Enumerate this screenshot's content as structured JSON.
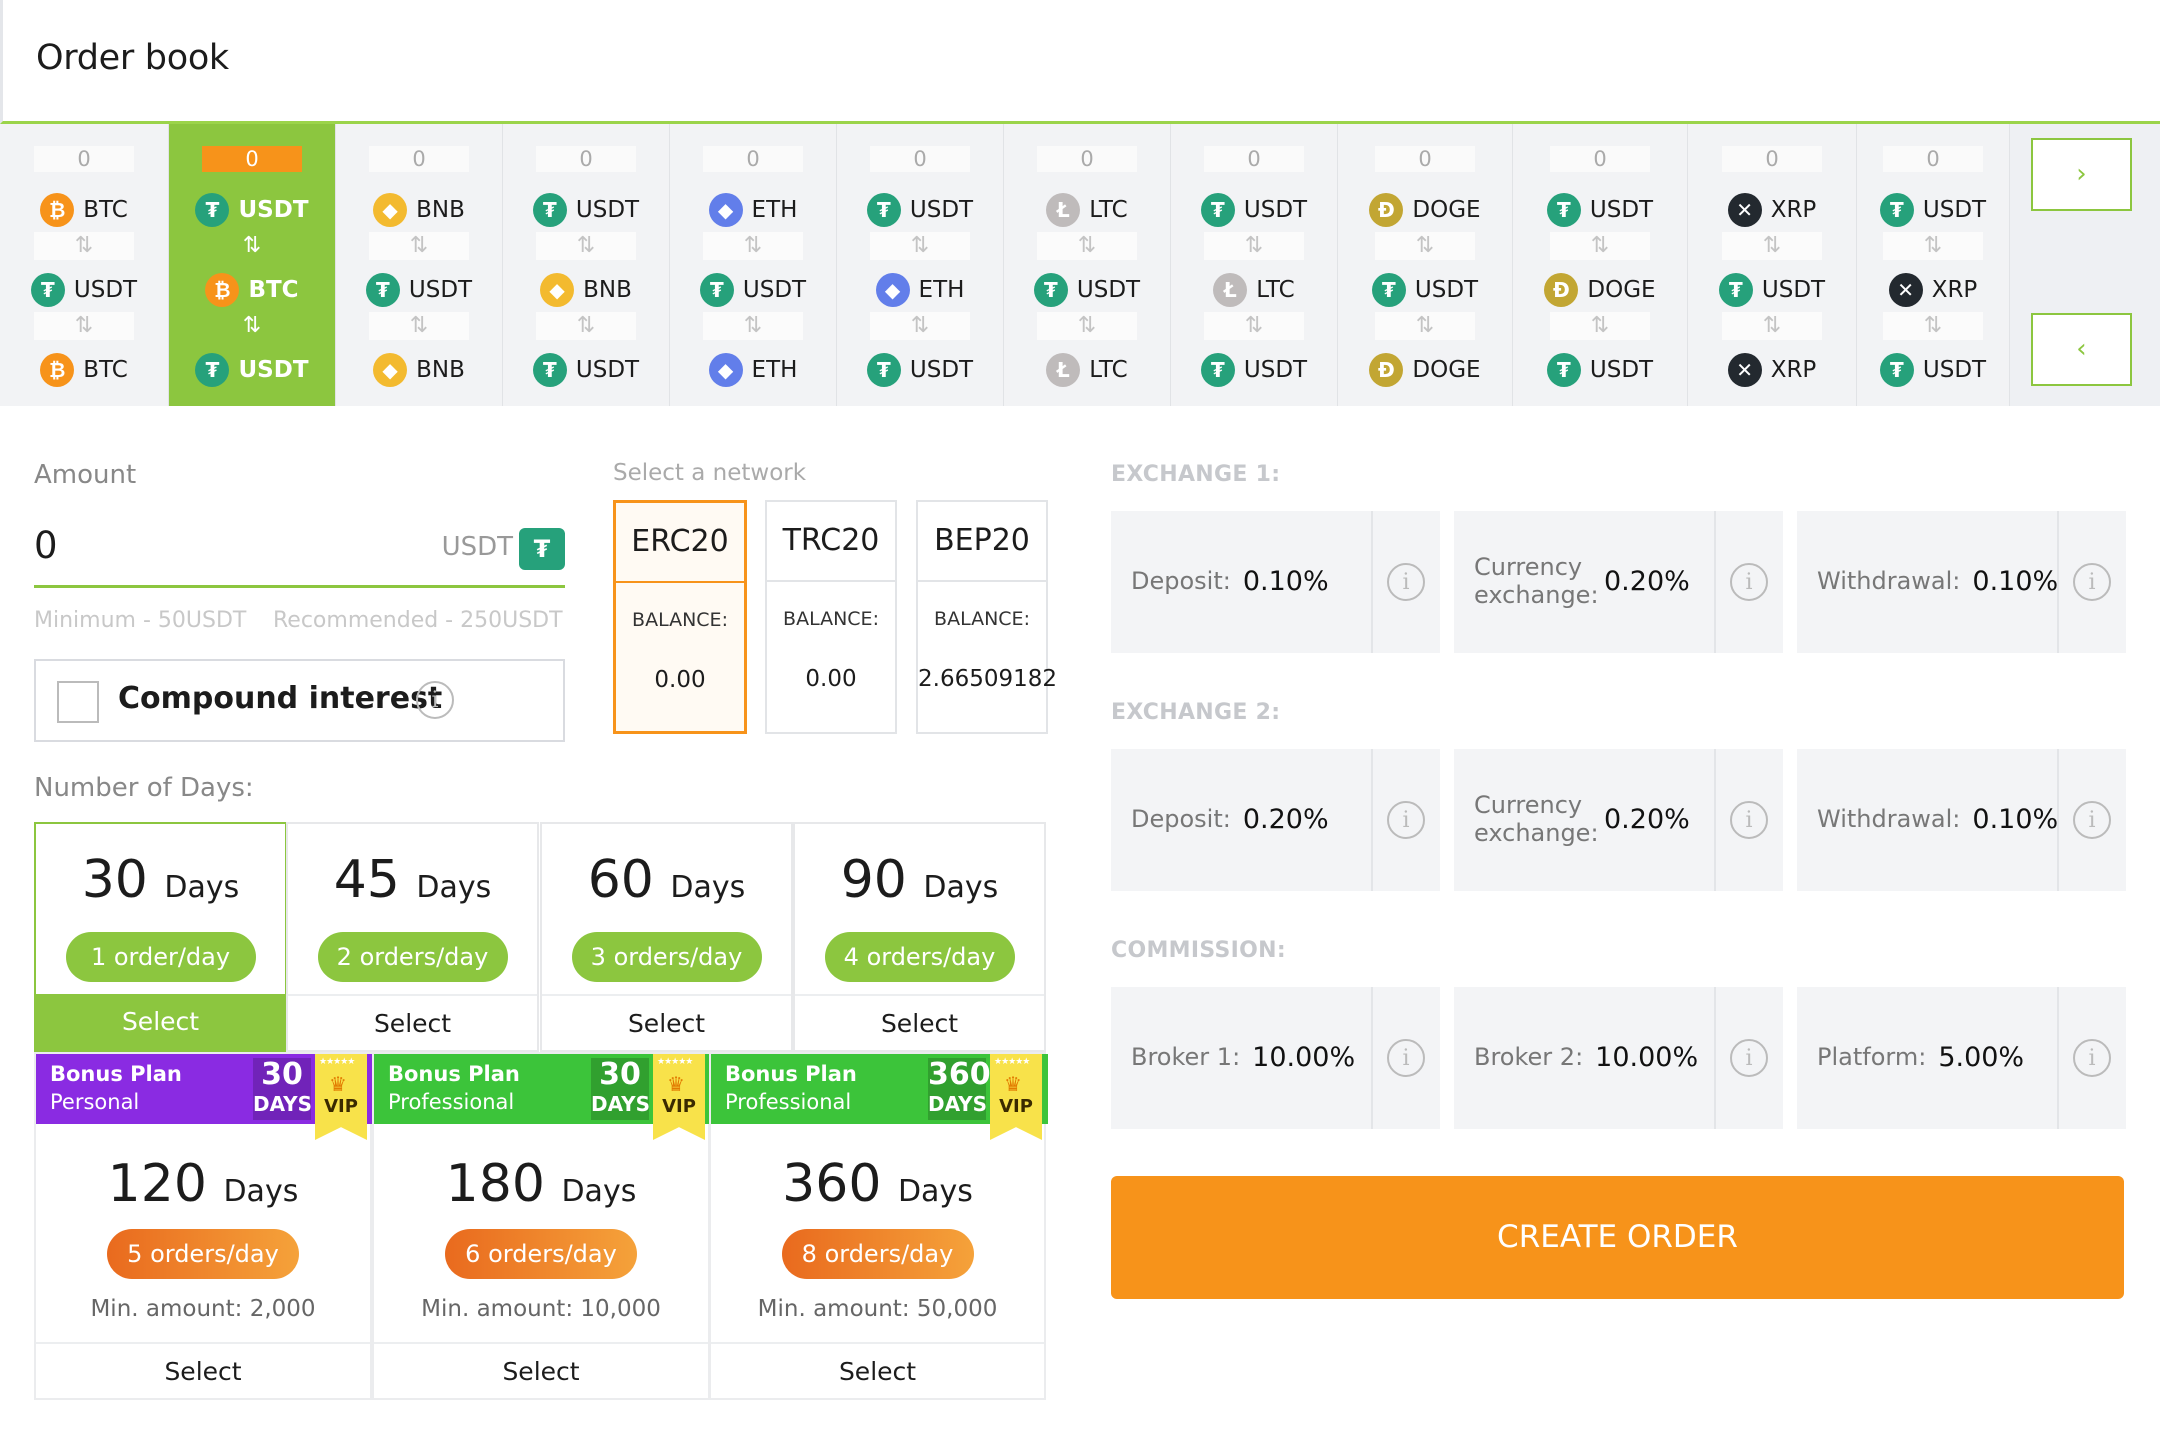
{
  "header": {
    "title": "Order book"
  },
  "pairs": [
    {
      "count": "0",
      "from": {
        "name": "BTC",
        "icon": "btc-icon",
        "cls": "c-btc",
        "glyph": "₿"
      },
      "to": {
        "name": "USDT",
        "icon": "usdt-icon",
        "cls": "c-usdt",
        "glyph": "₮"
      },
      "back": {
        "name": "BTC",
        "icon": "btc-icon",
        "cls": "c-btc",
        "glyph": "₿"
      }
    },
    {
      "count": "0",
      "from": {
        "name": "USDT",
        "icon": "usdt-icon",
        "cls": "c-usdt",
        "glyph": "₮"
      },
      "to": {
        "name": "BTC",
        "icon": "btc-icon",
        "cls": "c-btc",
        "glyph": "₿"
      },
      "back": {
        "name": "USDT",
        "icon": "usdt-icon",
        "cls": "c-usdt",
        "glyph": "₮"
      }
    },
    {
      "count": "0",
      "from": {
        "name": "BNB",
        "icon": "bnb-icon",
        "cls": "c-bnb",
        "glyph": "◆"
      },
      "to": {
        "name": "USDT",
        "icon": "usdt-icon",
        "cls": "c-usdt",
        "glyph": "₮"
      },
      "back": {
        "name": "BNB",
        "icon": "bnb-icon",
        "cls": "c-bnb",
        "glyph": "◆"
      }
    },
    {
      "count": "0",
      "from": {
        "name": "USDT",
        "icon": "usdt-icon",
        "cls": "c-usdt",
        "glyph": "₮"
      },
      "to": {
        "name": "BNB",
        "icon": "bnb-icon",
        "cls": "c-bnb",
        "glyph": "◆"
      },
      "back": {
        "name": "USDT",
        "icon": "usdt-icon",
        "cls": "c-usdt",
        "glyph": "₮"
      }
    },
    {
      "count": "0",
      "from": {
        "name": "ETH",
        "icon": "eth-icon",
        "cls": "c-eth",
        "glyph": "◆"
      },
      "to": {
        "name": "USDT",
        "icon": "usdt-icon",
        "cls": "c-usdt",
        "glyph": "₮"
      },
      "back": {
        "name": "ETH",
        "icon": "eth-icon",
        "cls": "c-eth",
        "glyph": "◆"
      }
    },
    {
      "count": "0",
      "from": {
        "name": "USDT",
        "icon": "usdt-icon",
        "cls": "c-usdt",
        "glyph": "₮"
      },
      "to": {
        "name": "ETH",
        "icon": "eth-icon",
        "cls": "c-eth",
        "glyph": "◆"
      },
      "back": {
        "name": "USDT",
        "icon": "usdt-icon",
        "cls": "c-usdt",
        "glyph": "₮"
      }
    },
    {
      "count": "0",
      "from": {
        "name": "LTC",
        "icon": "ltc-icon",
        "cls": "c-ltc",
        "glyph": "Ł"
      },
      "to": {
        "name": "USDT",
        "icon": "usdt-icon",
        "cls": "c-usdt",
        "glyph": "₮"
      },
      "back": {
        "name": "LTC",
        "icon": "ltc-icon",
        "cls": "c-ltc",
        "glyph": "Ł"
      }
    },
    {
      "count": "0",
      "from": {
        "name": "USDT",
        "icon": "usdt-icon",
        "cls": "c-usdt",
        "glyph": "₮"
      },
      "to": {
        "name": "LTC",
        "icon": "ltc-icon",
        "cls": "c-ltc",
        "glyph": "Ł"
      },
      "back": {
        "name": "USDT",
        "icon": "usdt-icon",
        "cls": "c-usdt",
        "glyph": "₮"
      }
    },
    {
      "count": "0",
      "from": {
        "name": "DOGE",
        "icon": "doge-icon",
        "cls": "c-doge",
        "glyph": "Đ"
      },
      "to": {
        "name": "USDT",
        "icon": "usdt-icon",
        "cls": "c-usdt",
        "glyph": "₮"
      },
      "back": {
        "name": "DOGE",
        "icon": "doge-icon",
        "cls": "c-doge",
        "glyph": "Đ"
      }
    },
    {
      "count": "0",
      "from": {
        "name": "USDT",
        "icon": "usdt-icon",
        "cls": "c-usdt",
        "glyph": "₮"
      },
      "to": {
        "name": "DOGE",
        "icon": "doge-icon",
        "cls": "c-doge",
        "glyph": "Đ"
      },
      "back": {
        "name": "USDT",
        "icon": "usdt-icon",
        "cls": "c-usdt",
        "glyph": "₮"
      }
    },
    {
      "count": "0",
      "from": {
        "name": "XRP",
        "icon": "xrp-icon",
        "cls": "c-xrp",
        "glyph": "✕"
      },
      "to": {
        "name": "USDT",
        "icon": "usdt-icon",
        "cls": "c-usdt",
        "glyph": "₮"
      },
      "back": {
        "name": "XRP",
        "icon": "xrp-icon",
        "cls": "c-xrp",
        "glyph": "✕"
      }
    },
    {
      "count": "0",
      "from": {
        "name": "USDT",
        "icon": "usdt-icon",
        "cls": "c-usdt",
        "glyph": "₮"
      },
      "to": {
        "name": "XRP",
        "icon": "xrp-icon",
        "cls": "c-xrp",
        "glyph": "✕"
      },
      "back": {
        "name": "USDT",
        "icon": "usdt-icon",
        "cls": "c-usdt",
        "glyph": "₮"
      }
    }
  ],
  "active_pair_index": 1,
  "swap_glyph": "⇅",
  "nav": {
    "next": "›",
    "prev": "‹"
  },
  "amount": {
    "label": "Amount",
    "value": "0",
    "unit": "USDT",
    "unit_glyph": "₮",
    "minimum": "Minimum - 50USDT",
    "recommended": "Recommended - 250USDT"
  },
  "compound": {
    "label": "Compound interest",
    "info_glyph": "i"
  },
  "network": {
    "label": "Select a network",
    "balance_label": "BALANCE:",
    "options": [
      {
        "name": "ERC20",
        "balance": "0.00",
        "selected": true
      },
      {
        "name": "TRC20",
        "balance": "0.00",
        "selected": false
      },
      {
        "name": "BEP20",
        "balance": "2.66509182",
        "selected": false
      }
    ]
  },
  "days": {
    "label": "Number of Days:",
    "days_word": "Days",
    "select_label": "Select",
    "plans": [
      {
        "num": "30",
        "orders": "1 order/day",
        "selected": true
      },
      {
        "num": "45",
        "orders": "2 orders/day",
        "selected": false
      },
      {
        "num": "60",
        "orders": "3 orders/day",
        "selected": false
      },
      {
        "num": "90",
        "orders": "4 orders/day",
        "selected": false
      }
    ]
  },
  "bonus": {
    "vip_label": "VIP",
    "stars": "★★★★★",
    "plans": [
      {
        "title": "Bonus Plan",
        "tier": "Personal",
        "badge_num": "30",
        "badge_unit": "DAYS",
        "num": "120",
        "orders": "5 orders/day",
        "min": "Min. amount: 2,000",
        "color": "#8a2be2"
      },
      {
        "title": "Bonus Plan",
        "tier": "Professional",
        "badge_num": "30",
        "badge_unit": "DAYS",
        "num": "180",
        "orders": "6 orders/day",
        "min": "Min. amount: 10,000",
        "color": "#3cc43a"
      },
      {
        "title": "Bonus Plan",
        "tier": "Professional",
        "badge_num": "360",
        "badge_unit": "DAYS",
        "num": "360",
        "orders": "8 orders/day",
        "min": "Min. amount: 50,000",
        "color": "#3cc43a"
      }
    ]
  },
  "exchange1": {
    "title": "EXCHANGE 1:",
    "fees": [
      {
        "label": "Deposit:",
        "value": "0.10%"
      },
      {
        "label": "Currency exchange:",
        "value": "0.20%"
      },
      {
        "label": "Withdrawal:",
        "value": "0.10%"
      }
    ]
  },
  "exchange2": {
    "title": "EXCHANGE 2:",
    "fees": [
      {
        "label": "Deposit:",
        "value": "0.20%"
      },
      {
        "label": "Currency exchange:",
        "value": "0.20%"
      },
      {
        "label": "Withdrawal:",
        "value": "0.10%"
      }
    ]
  },
  "commission": {
    "title": "COMMISSION:",
    "fees": [
      {
        "label": "Broker 1:",
        "value": "10.00%"
      },
      {
        "label": "Broker 2:",
        "value": "10.00%"
      },
      {
        "label": "Platform:",
        "value": "5.00%"
      }
    ]
  },
  "create_button": "CREATE ORDER",
  "colors": {
    "accent_green": "#8cc63f",
    "accent_orange": "#f7931a"
  }
}
